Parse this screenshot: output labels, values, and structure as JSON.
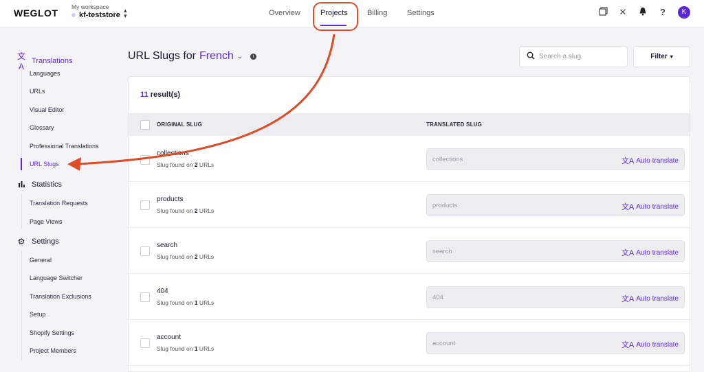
{
  "app": {
    "logo": "WEGLOT"
  },
  "workspace": {
    "label": "My workspace",
    "name": "kf-teststore"
  },
  "nav": [
    "Overview",
    "Projects",
    "Billing",
    "Settings"
  ],
  "user": {
    "initial": "K"
  },
  "sidebar": {
    "sections": [
      {
        "label": "Translations",
        "icon": "translate-icon",
        "items": [
          "Languages",
          "URLs",
          "Visual Editor",
          "Glossary",
          "Professional Translations",
          "URL Slugs"
        ]
      },
      {
        "label": "Statistics",
        "icon": "bar-chart-icon",
        "items": [
          "Translation Requests",
          "Page Views"
        ]
      },
      {
        "label": "Settings",
        "icon": "gear-icon",
        "items": [
          "General",
          "Language Switcher",
          "Translation Exclusions",
          "Setup",
          "Shopify Settings",
          "Project Members"
        ]
      }
    ]
  },
  "page": {
    "title_prefix": "URL Slugs for",
    "language": "French",
    "search_placeholder": "Search a slug",
    "filter_label": "Filter"
  },
  "table": {
    "result_count": "11",
    "result_suffix": " result(s)",
    "headers": {
      "original": "ORIGINAL SLUG",
      "translated": "TRANSLATED SLUG"
    },
    "found_prefix": "Slug found on ",
    "found_suffix": " URLs",
    "auto_label": "Auto translate",
    "rows": [
      {
        "slug": "collections",
        "count": "2",
        "placeholder": "collections"
      },
      {
        "slug": "products",
        "count": "2",
        "placeholder": "products"
      },
      {
        "slug": "search",
        "count": "2",
        "placeholder": "search"
      },
      {
        "slug": "404",
        "count": "1",
        "placeholder": "404"
      },
      {
        "slug": "account",
        "count": "1",
        "placeholder": "account"
      }
    ]
  },
  "colors": {
    "accent": "#5b2ad6",
    "annotation": "#e04a26"
  }
}
